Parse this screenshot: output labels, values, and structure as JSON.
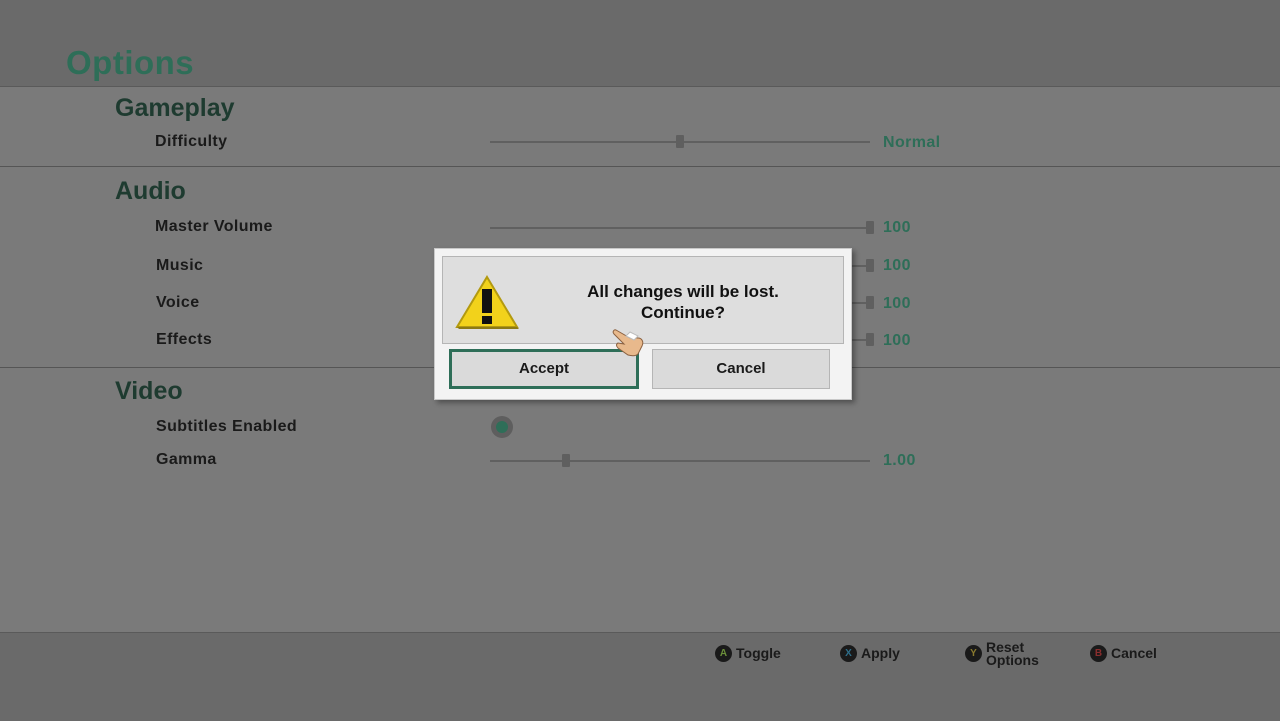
{
  "page_title": "Options",
  "sections": {
    "gameplay": {
      "title": "Gameplay",
      "difficulty": {
        "label": "Difficulty",
        "value": "Normal",
        "level": 0.5
      }
    },
    "audio": {
      "title": "Audio",
      "master_volume": {
        "label": "Master Volume",
        "value": "100"
      },
      "music": {
        "label": "Music",
        "value": "100"
      },
      "voice": {
        "label": "Voice",
        "value": "100"
      },
      "effects": {
        "label": "Effects",
        "value": "100"
      }
    },
    "video": {
      "title": "Video",
      "subtitles": {
        "label": "Subtitles Enabled",
        "enabled": true
      },
      "gamma": {
        "label": "Gamma",
        "value": "1.00"
      }
    }
  },
  "dialog": {
    "message_line1": "All changes will be lost.",
    "message_line2": "Continue?",
    "accept_label": "Accept",
    "cancel_label": "Cancel",
    "icon": "warning-icon"
  },
  "hints": [
    {
      "button": "A",
      "label": "Toggle"
    },
    {
      "button": "X",
      "label": "Apply"
    },
    {
      "button": "Y",
      "label_line1": "Reset",
      "label_line2": "Options"
    },
    {
      "button": "B",
      "label": "Cancel"
    }
  ],
  "colors": {
    "accent": "#2e6e58",
    "section_title": "#1e3b30",
    "background": "#7a7a7a",
    "dialog_bg": "#f3f3f3",
    "warning_yellow": "#f2d21b"
  }
}
